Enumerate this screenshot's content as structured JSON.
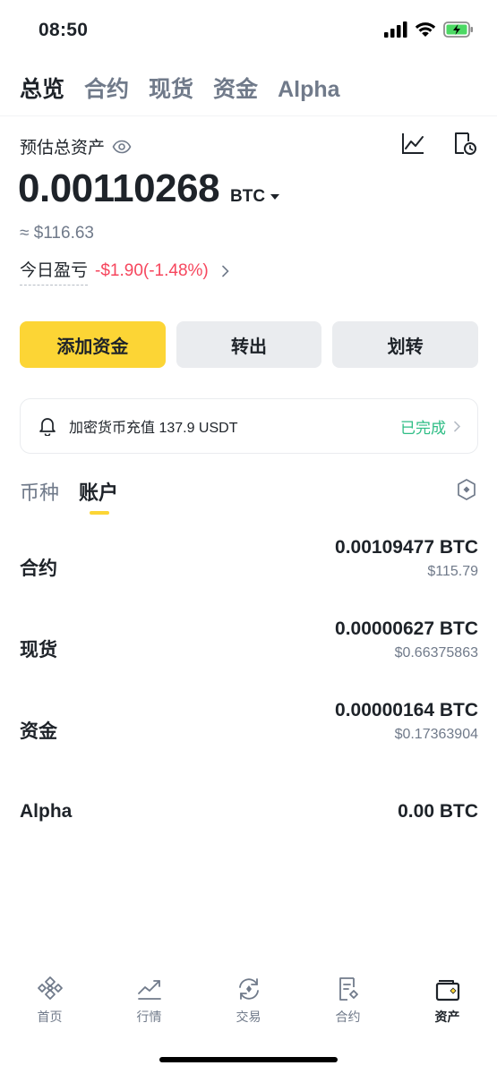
{
  "status_bar": {
    "time": "08:50"
  },
  "top_tabs": [
    {
      "label": "总览",
      "active": true
    },
    {
      "label": "合约",
      "active": false
    },
    {
      "label": "现货",
      "active": false
    },
    {
      "label": "资金",
      "active": false
    },
    {
      "label": "Alpha",
      "active": false
    }
  ],
  "overview": {
    "estimated_label": "预估总资产",
    "balance": "0.00110268",
    "unit": "BTC",
    "usd_value": "≈ $116.63",
    "pnl_label": "今日盈亏",
    "pnl_value": "-$1.90(-1.48%)"
  },
  "actions": {
    "add_funds": "添加资金",
    "withdraw": "转出",
    "transfer": "划转"
  },
  "notice": {
    "text": "加密货币充值 137.9 USDT",
    "status": "已完成"
  },
  "sub_tabs": [
    {
      "label": "币种",
      "active": false
    },
    {
      "label": "账户",
      "active": true
    }
  ],
  "accounts": [
    {
      "name": "合约",
      "btc": "0.00109477 BTC",
      "usd": "$115.79"
    },
    {
      "name": "现货",
      "btc": "0.00000627 BTC",
      "usd": "$0.66375863"
    },
    {
      "name": "资金",
      "btc": "0.00000164 BTC",
      "usd": "$0.17363904"
    },
    {
      "name": "Alpha",
      "btc": "0.00 BTC",
      "usd": ""
    }
  ],
  "bottom_nav": [
    {
      "label": "首页",
      "icon": "binance-logo-icon",
      "active": false
    },
    {
      "label": "行情",
      "icon": "markets-chart-icon",
      "active": false
    },
    {
      "label": "交易",
      "icon": "trade-swap-icon",
      "active": false
    },
    {
      "label": "合约",
      "icon": "futures-doc-icon",
      "active": false
    },
    {
      "label": "资产",
      "icon": "wallet-icon",
      "active": true
    }
  ],
  "colors": {
    "accent_yellow": "#fcd535",
    "loss_red": "#f6465d",
    "success_green": "#2ebd85",
    "text_primary": "#1e2329",
    "text_secondary": "#707a8a"
  }
}
